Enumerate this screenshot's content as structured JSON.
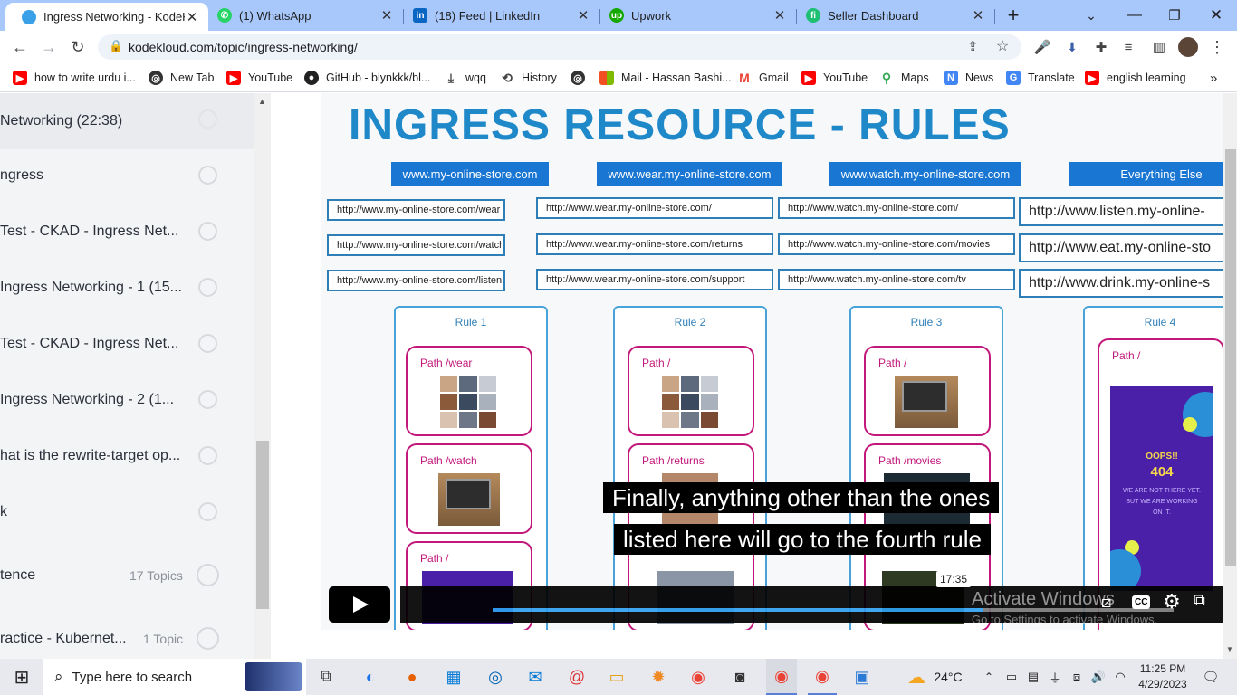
{
  "browser": {
    "tabs": [
      {
        "title": "Ingress Networking - KodeKl",
        "active": true,
        "favicon_color": "#3aa0e8"
      },
      {
        "title": "(1) WhatsApp",
        "active": false,
        "favicon_color": "#25d366"
      },
      {
        "title": "(18) Feed | LinkedIn",
        "active": false,
        "favicon_color": "#0a66c2"
      },
      {
        "title": "Upwork",
        "active": false,
        "favicon_color": "#14a800"
      },
      {
        "title": "Seller Dashboard",
        "active": false,
        "favicon_color": "#1dbf73"
      }
    ],
    "url": "kodekloud.com/topic/ingress-networking/",
    "bookmarks": [
      {
        "label": "how to write urdu i...",
        "icon": "youtube-icon",
        "color": "#ff0000"
      },
      {
        "label": "New Tab",
        "icon": "globe-icon",
        "color": "#333"
      },
      {
        "label": "YouTube",
        "icon": "youtube-icon",
        "color": "#ff0000"
      },
      {
        "label": "GitHub - blynkkk/bl...",
        "icon": "github-icon",
        "color": "#222"
      },
      {
        "label": "wqq",
        "icon": "download-icon",
        "color": "#444"
      },
      {
        "label": "History",
        "icon": "history-icon",
        "color": "#444"
      },
      {
        "label": "",
        "icon": "globe-icon",
        "color": "#333"
      },
      {
        "label": "Mail - Hassan Bashi...",
        "icon": "microsoft-icon",
        "color": "#f25022"
      },
      {
        "label": "Gmail",
        "icon": "gmail-icon",
        "color": "#ea4335"
      },
      {
        "label": "YouTube",
        "icon": "youtube-icon",
        "color": "#ff0000"
      },
      {
        "label": "Maps",
        "icon": "maps-icon",
        "color": "#34a853"
      },
      {
        "label": "News",
        "icon": "news-icon",
        "color": "#4285f4"
      },
      {
        "label": "Translate",
        "icon": "translate-icon",
        "color": "#4285f4"
      },
      {
        "label": "english learning",
        "icon": "youtube-icon",
        "color": "#ff0000"
      }
    ]
  },
  "sidebar": {
    "items": [
      {
        "label": "Networking (22:38)",
        "topics": ""
      },
      {
        "label": "ngress",
        "topics": ""
      },
      {
        "label": "Test - CKAD - Ingress Net...",
        "topics": ""
      },
      {
        "label": " Ingress Networking - 1 (15...",
        "topics": ""
      },
      {
        "label": "Test - CKAD - Ingress Net...",
        "topics": ""
      },
      {
        "label": " Ingress Networking - 2 (1...",
        "topics": ""
      },
      {
        "label": "hat is the rewrite-target op...",
        "topics": ""
      },
      {
        "label": "k",
        "topics": ""
      },
      {
        "label": "tence",
        "topics": "17 Topics"
      },
      {
        "label": "ractice - Kubernet...",
        "topics": "1 Topic"
      }
    ]
  },
  "video": {
    "slide_title": "INGRESS RESOURCE - RULES",
    "hosts": [
      "www.my-online-store.com",
      "www.wear.my-online-store.com",
      "www.watch.my-online-store.com",
      "Everything Else"
    ],
    "url_columns": [
      [
        "http://www.my-online-store.com/wear",
        "http://www.my-online-store.com/watch",
        "http://www.my-online-store.com/listen"
      ],
      [
        "http://www.wear.my-online-store.com/",
        "http://www.wear.my-online-store.com/returns",
        "http://www.wear.my-online-store.com/support"
      ],
      [
        "http://www.watch.my-online-store.com/",
        "http://www.watch.my-online-store.com/movies",
        "http://www.watch.my-online-store.com/tv"
      ],
      [
        "http://www.listen.my-online-",
        "http://www.eat.my-online-sto",
        "http://www.drink.my-online-s"
      ]
    ],
    "rules": [
      {
        "title": "Rule 1",
        "paths": [
          "Path /wear",
          "Path /watch",
          "Path /"
        ]
      },
      {
        "title": "Rule 2",
        "paths": [
          "Path /",
          "Path /returns",
          ""
        ]
      },
      {
        "title": "Rule 3",
        "paths": [
          "Path /",
          "Path /movies",
          ""
        ]
      },
      {
        "title": "Rule 4",
        "paths": [
          "Path /"
        ]
      }
    ],
    "error_card": {
      "title": "OOPS!!",
      "code": "404",
      "message": "WE ARE NOT THERE YET. BUT WE ARE WORKING ON IT."
    },
    "subtitle_line1": "Finally, anything other than the ones",
    "subtitle_line2": "listed here will go to the fourth rule",
    "time_tooltip": "17:35",
    "progress": 0.72,
    "watermark_line1": "Activate Windows",
    "watermark_line2": "Go to Settings to activate Windows.",
    "cc_label": "CC"
  },
  "taskbar": {
    "search_placeholder": "Type here to search",
    "weather": "24°C",
    "time": "11:25 PM",
    "date": "4/29/2023"
  }
}
